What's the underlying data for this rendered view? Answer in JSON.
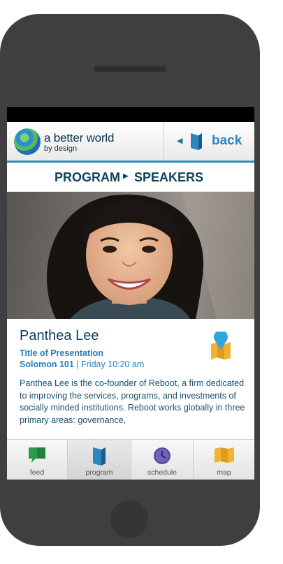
{
  "header": {
    "brand_line1": "a better world",
    "brand_line2": "by design",
    "back_label": "back"
  },
  "breadcrumb": {
    "section": "PROGRAM",
    "page": "SPEAKERS"
  },
  "speaker": {
    "name": "Panthea Lee",
    "talk_title": "Title of Presentation",
    "room": "Solomon 101",
    "separator": " | ",
    "time": "Friday 10:20 am",
    "bio": "Panthea Lee is the co-founder of Reboot, a firm dedicated to improving the services, programs, and investments of socially minded institutions. Reboot works globally in three primary areas: governance,"
  },
  "tabs": [
    {
      "label": "feed",
      "icon": "speech-bubble-icon"
    },
    {
      "label": "program",
      "icon": "book-icon"
    },
    {
      "label": "schedule",
      "icon": "clock-icon"
    },
    {
      "label": "map",
      "icon": "map-icon"
    }
  ],
  "active_tab": "program",
  "colors": {
    "accent_blue": "#2b86c2",
    "navy": "#10425f",
    "feed_green": "#2e9b4a",
    "schedule_purple": "#5a4aa0",
    "map_yellow": "#f2b233"
  }
}
